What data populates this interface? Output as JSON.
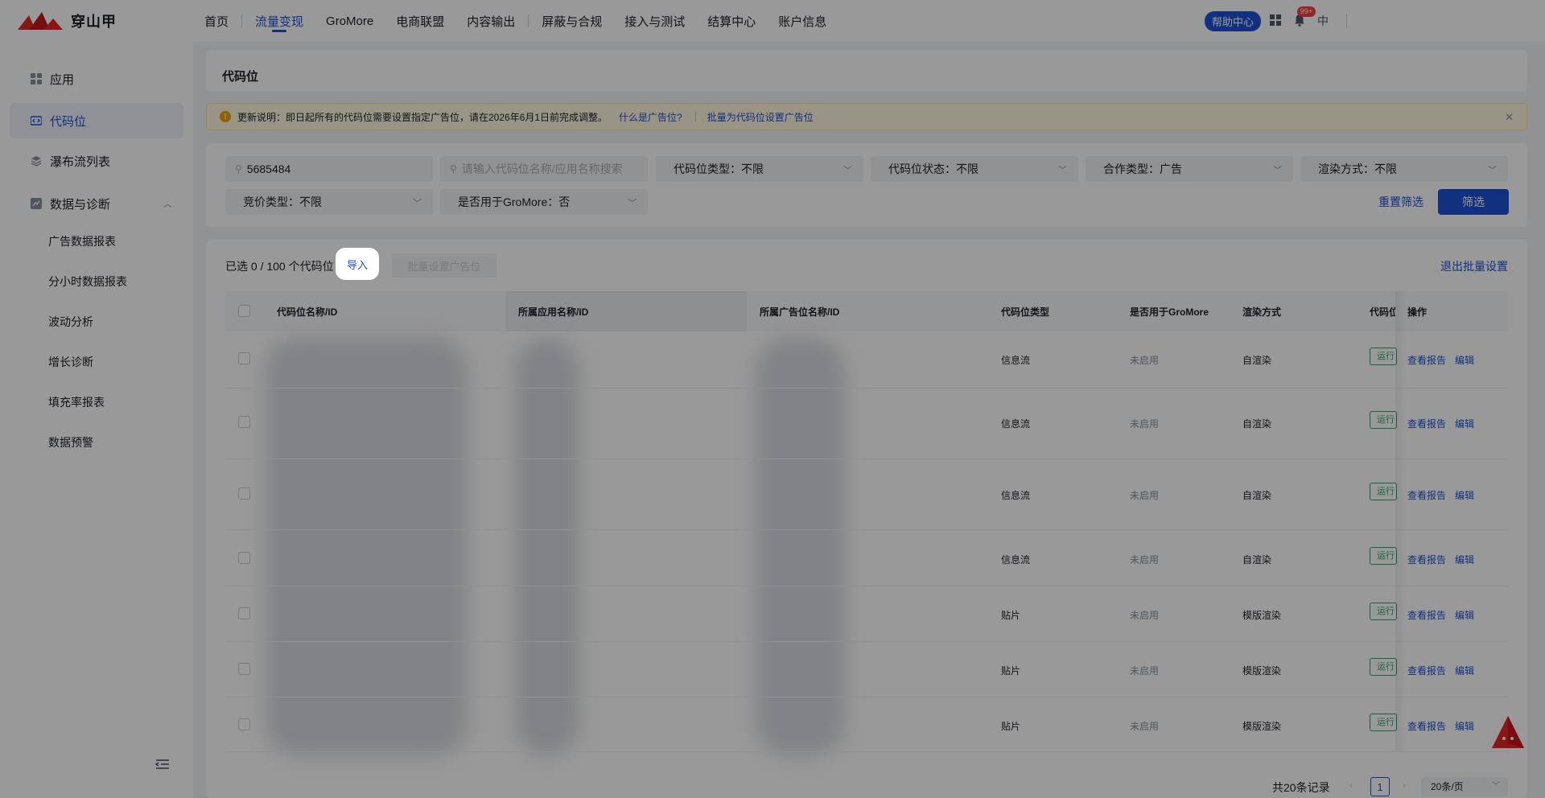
{
  "header": {
    "logo_text": "穿山甲",
    "nav": [
      {
        "label": "首页"
      },
      {
        "label": "流量变现"
      },
      {
        "label": "GroMore"
      },
      {
        "label": "电商联盟"
      },
      {
        "label": "内容输出"
      },
      {
        "label": "屏蔽与合规"
      },
      {
        "label": "接入与测试"
      },
      {
        "label": "结算中心"
      },
      {
        "label": "账户信息"
      }
    ],
    "help_label": "帮助中心",
    "bell_badge": "99+",
    "lang_label": "中"
  },
  "sidebar": {
    "items": [
      {
        "label": "应用"
      },
      {
        "label": "代码位"
      },
      {
        "label": "瀑布流列表"
      },
      {
        "label": "数据与诊断"
      }
    ],
    "sub_items": [
      {
        "label": "广告数据报表"
      },
      {
        "label": "分小时数据报表"
      },
      {
        "label": "波动分析"
      },
      {
        "label": "增长诊断"
      },
      {
        "label": "填充率报表"
      },
      {
        "label": "数据预警"
      }
    ]
  },
  "page": {
    "title": "代码位"
  },
  "notice": {
    "text": "更新说明：即日起所有的代码位需要设置指定广告位，请在2026年6月1日前完成调整。",
    "link1": "什么是广告位?",
    "link2": "批量为代码位设置广告位"
  },
  "filters": {
    "search_value": "5685484",
    "search_placeholder": "请输入代码位名称/应用名称搜索",
    "slot_type": "代码位类型：不限",
    "slot_status": "代码位状态：不限",
    "coop_type": "合作类型：广告",
    "render_mode": "渲染方式：不限",
    "bid_type": "竞价类型：不限",
    "gromore": "是否用于GroMore：否",
    "reset_label": "重置筛选",
    "submit_label": "筛选"
  },
  "toolbar": {
    "selected_text": "已选 0 / 100 个代码位",
    "import_label": "导入",
    "batch_label": "批量设置广告位",
    "exit_label": "退出批量设置"
  },
  "table": {
    "headers": [
      "代码位名称/ID",
      "所属应用名称/ID",
      "所属广告位名称/ID",
      "代码位类型",
      "是否用于GroMore",
      "渲染方式",
      "代码位",
      "操作"
    ],
    "rows": [
      {
        "type": "信息流",
        "gromore": "未启用",
        "render": "自渲染",
        "status": "运行中"
      },
      {
        "type": "信息流",
        "gromore": "未启用",
        "render": "自渲染",
        "status": "运行中"
      },
      {
        "type": "信息流",
        "gromore": "未启用",
        "render": "自渲染",
        "status": "运行中"
      },
      {
        "type": "信息流",
        "gromore": "未启用",
        "render": "自渲染",
        "status": "运行中"
      },
      {
        "type": "贴片",
        "gromore": "未启用",
        "render": "模版渲染",
        "status": "运行中"
      },
      {
        "type": "贴片",
        "gromore": "未启用",
        "render": "模版渲染",
        "status": "运行中"
      },
      {
        "type": "贴片",
        "gromore": "未启用",
        "render": "模版渲染",
        "status": "运行中"
      }
    ],
    "action_report": "查看报告",
    "action_edit": "编辑"
  },
  "pagination": {
    "total_text": "共20条记录",
    "current_page": "1",
    "page_size": "20条/页"
  },
  "colors": {
    "accent": "#1e50d6",
    "status_green": "#2ba471",
    "notice_bg": "#fff7e0"
  }
}
